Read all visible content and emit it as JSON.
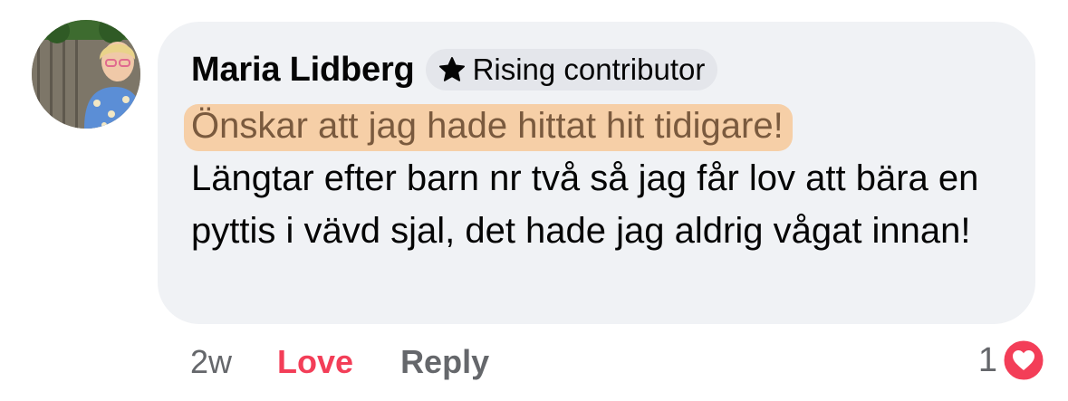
{
  "comment": {
    "author": "Maria Lidberg",
    "badge": {
      "icon": "star-icon",
      "label": "Rising contributor"
    },
    "highlighted_text": "Önskar att jag hade hittat hit tidigare!",
    "body_text": "Längtar efter barn nr två så jag får lov att bära en pyttis i vävd sjal, det hade jag aldrig vågat innan!",
    "highlight_color": "#f6cfa7",
    "bubble_color": "#f0f2f5"
  },
  "footer": {
    "timestamp": "2w",
    "love_label": "Love",
    "love_color": "#f33e58",
    "reply_label": "Reply"
  },
  "reactions": {
    "count": "1",
    "icon": "heart-reaction-icon",
    "color": "#f33e58"
  }
}
